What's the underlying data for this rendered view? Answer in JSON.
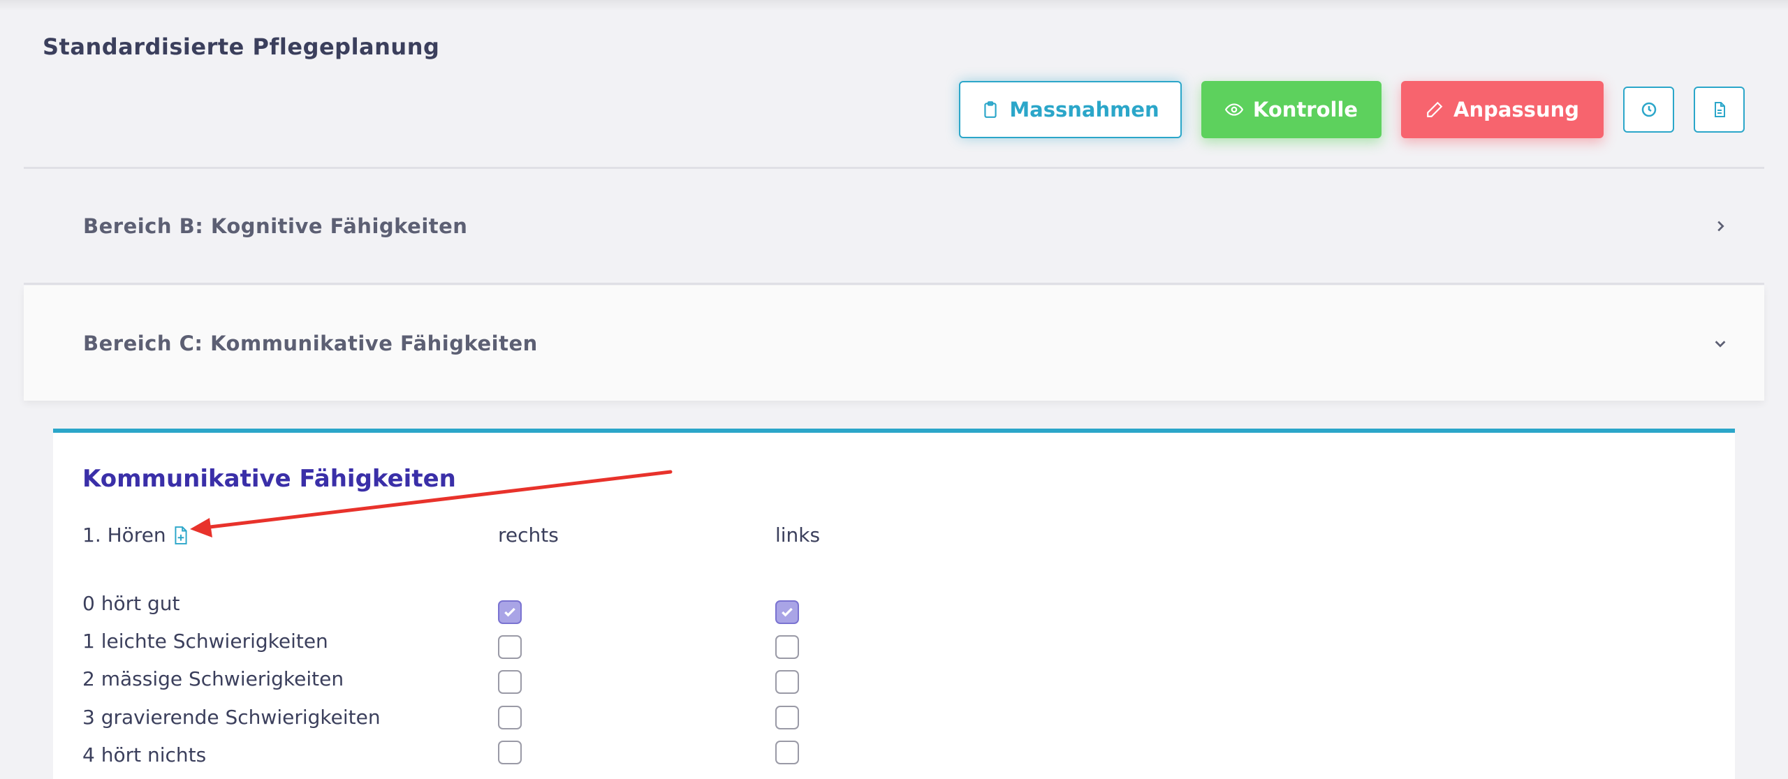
{
  "page": {
    "title": "Standardisierte Pflegeplanung"
  },
  "toolbar": {
    "massnahmen_label": "Massnahmen",
    "kontrolle_label": "Kontrolle",
    "anpassung_label": "Anpassung"
  },
  "sections": {
    "b_title": "Bereich B: Kognitive Fähigkeiten",
    "c_title": "Bereich C: Kommunikative Fähigkeiten"
  },
  "card": {
    "title": "Kommunikative Fähigkeiten",
    "question": "1. Hören",
    "col_rechts": "rechts",
    "col_links": "links",
    "options": [
      {
        "label": "0 hört gut",
        "rechts": true,
        "links": true
      },
      {
        "label": "1 leichte Schwierigkeiten",
        "rechts": false,
        "links": false
      },
      {
        "label": "2 mässige Schwierigkeiten",
        "rechts": false,
        "links": false
      },
      {
        "label": "3 gravierende Schwierigkeiten",
        "rechts": false,
        "links": false
      },
      {
        "label": "4 hört nichts",
        "rechts": false,
        "links": false
      }
    ]
  },
  "colors": {
    "accent": "#2ba6c9",
    "success": "#5dd15d",
    "danger": "#f7646e",
    "title_purple": "#3a2fa8",
    "annotation_arrow": "#e8322b"
  },
  "icons": {
    "massnahmen": "clipboard-icon",
    "kontrolle": "eye-icon",
    "anpassung": "pencil-icon",
    "history": "clock-icon",
    "document": "document-icon",
    "question": "file-plus-icon"
  }
}
